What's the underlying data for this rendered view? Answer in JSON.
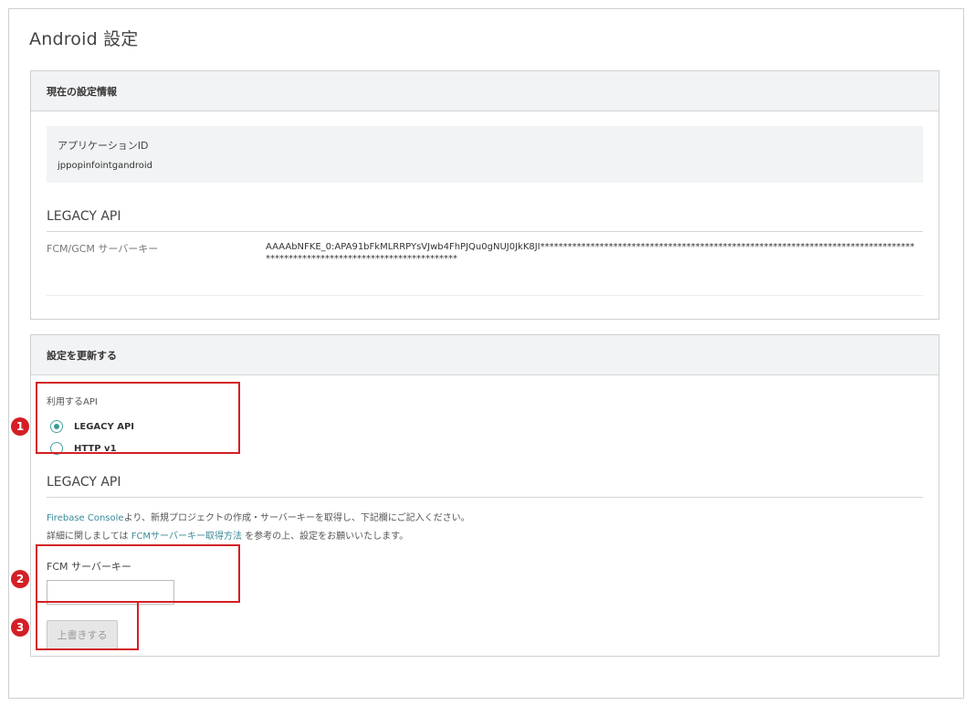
{
  "page": {
    "title": "Android 設定"
  },
  "current_settings": {
    "heading": "現在の設定情報",
    "app_id_label": "アプリケーションID",
    "app_id_value": "jppopinfointgandroid",
    "section_title": "LEGACY API",
    "server_key_label": "FCM/GCM サーバーキー",
    "server_key_value": "AAAAbNFKE_0:APA91bFkMLRRPYsVJwb4FhPJQu0gNUJ0JkK8JI****************************************************************************************************************************"
  },
  "update_settings": {
    "heading": "設定を更新する",
    "api_label": "利用するAPI",
    "radio_options": [
      {
        "label": "LEGACY API",
        "selected": true
      },
      {
        "label": "HTTP v1",
        "selected": false
      }
    ],
    "section_title": "LEGACY API",
    "desc_line1": {
      "link": "Firebase Console",
      "text": "より、新規プロジェクトの作成・サーバーキーを取得し、下記欄にご記入ください。"
    },
    "desc_line2": {
      "prefix": "詳細に関しましては ",
      "link": "FCMサーバーキー取得方法",
      "suffix": " を参考の上、設定をお願いいたします。"
    },
    "fcm_key_label": "FCM サーバーキー",
    "fcm_key_value": "",
    "overwrite_button": "上書きする"
  },
  "annotations": {
    "badge_1": "1",
    "badge_2": "2",
    "badge_3": "3",
    "highlight_color": "#d31f25"
  },
  "colors": {
    "accent": "#3a9a97",
    "link": "#3a8b9a",
    "panel_header_bg": "#f2f3f4"
  }
}
